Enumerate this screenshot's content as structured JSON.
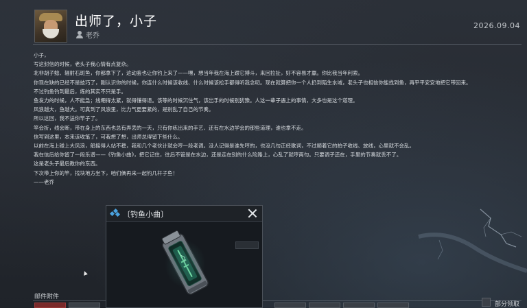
{
  "mail": {
    "title": "出师了，小子",
    "sender": "老乔",
    "date": "2026.09.04",
    "sender_icon": "person-icon",
    "avatar": "old-fisherman-avatar"
  },
  "letter": {
    "lines": [
      "小子，",
      "写这封信的时候，老头子我心情有点复杂。",
      "北非胡子鲶、辐射石斑鱼，你都拿下了，这动鉴也让你钓上来了——嘿，想当年我在海上跟它搏斗，来回拉扯，好不容易才赢。你比我当年利索。",
      "你现在缺的已经不是技巧了，刚认识你的时候，你连什么时候该收线、什么时候该松手都得听我念叨。现在就算把你一个人扔到陌生水域，老头子也相信你能找到鱼，再平平安安地把它带回来。",
      "不过钓鱼钓到最后，练的其实不只是手。",
      "鱼发力的时候，人不能急；线绷得太紧，就得懂得退。该等的时候沉住气，该出手的时候别犹豫。人这一辈子遇上的事情，大多也是这个道理。",
      "风浪越大，鱼越大。可真到了风浪里，比力气更要紧的，是别乱了自己的节奏。",
      "所以这回，我不送你竿子了。",
      "竿会折，线会断，带在身上的东西也总有弄丢的一天，只有你练出来的手艺、还有在水边学会的那些道理，谁也拿不走。",
      "信写到这里，本来该收笔了，可我想了想，出师总得留下些什么。",
      "以前在海上碰上大风浪，船摇得人站不稳，我和几个老伙计就会哼一段老调。没人记得是谁先哼的，也没几句正经歌词，不过顺着它的拍子收线、放线，心里就不会乱。",
      "我在信后给你留了一段乐谱——《钓鱼小曲》，把它记住，往后不管是在水边，还是走在别的什么险路上，心乱了就哼两句。只要调子还在，手里的节奏就丢不了。",
      "这是老头子最后教你的东西。",
      "下次带上你的竿，找块地方坐下，咱们俩再来一起钓几杆子鱼！",
      "——老乔"
    ]
  },
  "attachments": {
    "label": "邮件附件",
    "claim_label": "部分领取"
  },
  "popup": {
    "title": "〔钓鱼小曲〕",
    "title_icon": "diamond-icon",
    "close_icon": "close-icon",
    "item": "music-cartridge-item"
  },
  "colors": {
    "background": "#262a31",
    "text": "#d8dce0",
    "accent": "#4aa3e0",
    "item_glow": "#36c58a"
  }
}
